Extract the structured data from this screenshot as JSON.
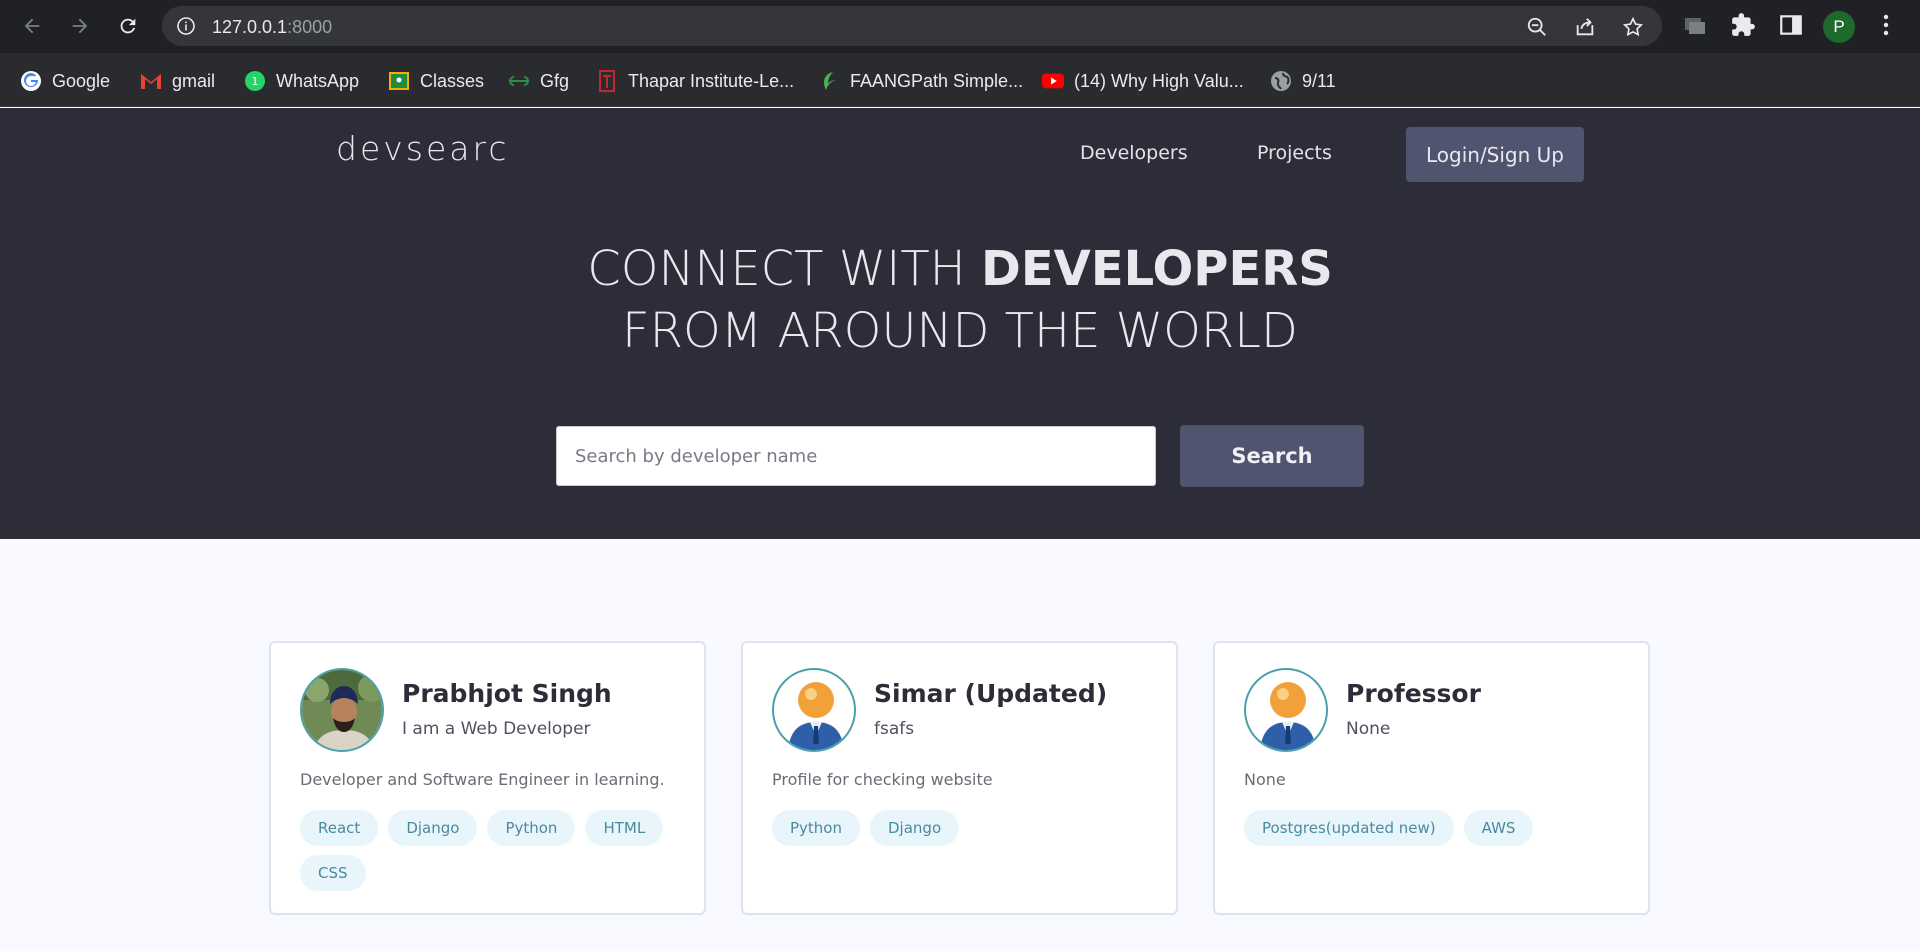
{
  "browser": {
    "url_host": "127.0.0.1",
    "url_port": ":8000",
    "profile_initial": "P",
    "bookmarks": [
      {
        "label": "Google",
        "icon": "google-icon"
      },
      {
        "label": "gmail",
        "icon": "gmail-icon"
      },
      {
        "label": "WhatsApp",
        "icon": "whatsapp-icon"
      },
      {
        "label": "Classes",
        "icon": "classroom-icon"
      },
      {
        "label": "Gfg",
        "icon": "gfg-icon"
      },
      {
        "label": "Thapar Institute-Le...",
        "icon": "thapar-icon"
      },
      {
        "label": "FAANGPath Simple...",
        "icon": "faangpath-icon"
      },
      {
        "label": "(14) Why High Valu...",
        "icon": "youtube-icon"
      },
      {
        "label": "9/11",
        "icon": "globe-icon"
      }
    ]
  },
  "site": {
    "logo": "devsearch",
    "nav": {
      "developers": "Developers",
      "projects": "Projects",
      "login": "Login/Sign Up"
    },
    "hero": {
      "line1_light": "CONNECT WITH ",
      "line1_bold": "DEVELOPERS",
      "line2": "FROM AROUND THE WORLD"
    },
    "search": {
      "placeholder": "Search by developer name",
      "button": "Search"
    }
  },
  "developers": [
    {
      "name": "Prabhjot Singh",
      "headline": "I am a Web Developer",
      "bio": "Developer and Software Engineer in learning.",
      "tags": [
        "React",
        "Django",
        "Python",
        "HTML",
        "CSS"
      ],
      "avatar": "photo"
    },
    {
      "name": "Simar (Updated)",
      "headline": "fsafs",
      "bio": "Profile for checking website",
      "tags": [
        "Python",
        "Django"
      ],
      "avatar": "default-user-icon"
    },
    {
      "name": "Professor",
      "headline": "None",
      "bio": "None",
      "tags": [
        "Postgres(updated new)",
        "AWS"
      ],
      "avatar": "default-user-icon"
    }
  ],
  "colors": {
    "hero_bg": "#2d2d3a",
    "button_bg": "#51546e",
    "tag_bg": "#e8f6fb",
    "tag_text": "#4a8aa0",
    "page_bg": "#f8faff"
  }
}
